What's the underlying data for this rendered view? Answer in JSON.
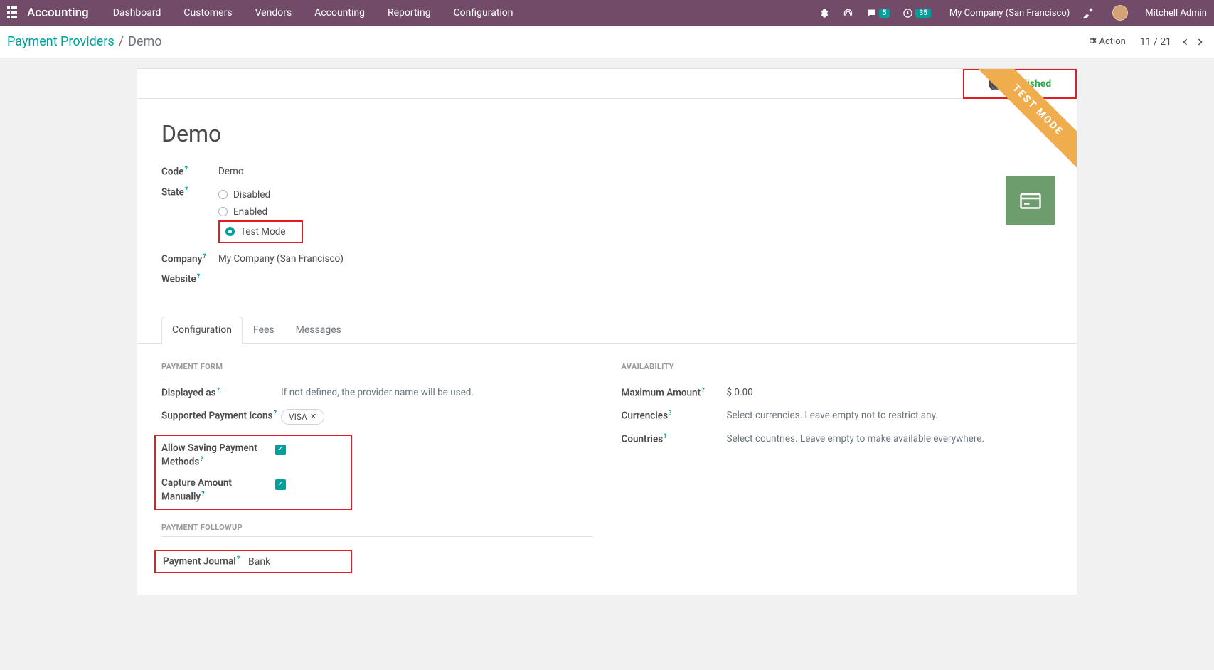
{
  "topbar": {
    "brand": "Accounting",
    "menu": [
      "Dashboard",
      "Customers",
      "Vendors",
      "Accounting",
      "Reporting",
      "Configuration"
    ],
    "msg_badge": "5",
    "activity_badge": "35",
    "company": "My Company (San Francisco)",
    "user": "Mitchell Admin"
  },
  "breadcrumb": {
    "parent": "Payment Providers",
    "current": "Demo",
    "action_label": "Action",
    "pager": "11 / 21"
  },
  "header": {
    "published": "Published",
    "ribbon": "TEST MODE",
    "title": "Demo"
  },
  "form": {
    "label_code": "Code",
    "code": "Demo",
    "label_state": "State",
    "state_disabled": "Disabled",
    "state_enabled": "Enabled",
    "state_test": "Test Mode",
    "label_company": "Company",
    "company": "My Company (San Francisco)",
    "label_website": "Website"
  },
  "tabs": [
    "Configuration",
    "Fees",
    "Messages"
  ],
  "pf": {
    "section": "Payment Form",
    "displayed_as": "Displayed as",
    "displayed_as_ph": "If not defined, the provider name will be used.",
    "icons_label": "Supported Payment Icons",
    "icon_tag": "VISA",
    "allow_save": "Allow Saving Payment Methods",
    "capture": "Capture Amount Manually"
  },
  "fup": {
    "section": "Payment Followup",
    "journal_label": "Payment Journal",
    "journal": "Bank"
  },
  "av": {
    "section": "Availability",
    "max_label": "Maximum Amount",
    "max_val": "$ 0.00",
    "curr_label": "Currencies",
    "curr_ph": "Select currencies. Leave empty not to restrict any.",
    "ctry_label": "Countries",
    "ctry_ph": "Select countries. Leave empty to make available everywhere."
  }
}
